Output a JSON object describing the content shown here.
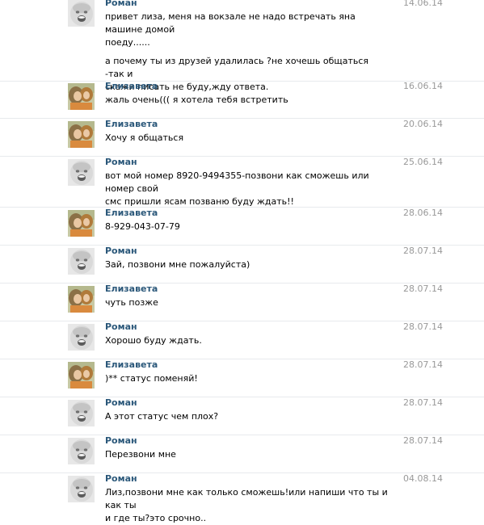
{
  "messages": [
    {
      "author": "Роман",
      "avatar": "baby-avatar",
      "date": "14.06.14",
      "text": [
        "привет лиза, меня на вокзале не надо встречать яна машине домой\nпоеду......",
        "а почему ты из друзей удалилась ?не хочешь общаться -так и\nскажи писать не буду,жду ответа."
      ]
    },
    {
      "author": "Елизавета",
      "avatar": "girl-avatar",
      "date": "16.06.14",
      "text": [
        "жаль очень((( я хотела тебя встретить"
      ]
    },
    {
      "author": "Елизавета",
      "avatar": "girl-avatar",
      "date": "20.06.14",
      "text": [
        "Хочу я общаться"
      ]
    },
    {
      "author": "Роман",
      "avatar": "baby-avatar",
      "date": "25.06.14",
      "text": [
        "вот мой номер 8920-9494355-позвони как сможешь или номер свой\nсмс пришли ясам позваню буду ждать!!"
      ]
    },
    {
      "author": "Елизавета",
      "avatar": "girl-avatar",
      "date": "28.06.14",
      "text": [
        "8-929-043-07-79"
      ]
    },
    {
      "author": "Роман",
      "avatar": "baby-avatar",
      "date": "28.07.14",
      "text": [
        "Зай, позвони мне пожалуйста)"
      ]
    },
    {
      "author": "Елизавета",
      "avatar": "girl-avatar",
      "date": "28.07.14",
      "text": [
        "чуть позже"
      ]
    },
    {
      "author": "Роман",
      "avatar": "baby-avatar",
      "date": "28.07.14",
      "text": [
        "Хорошо буду ждать."
      ]
    },
    {
      "author": "Елизавета",
      "avatar": "girl-avatar",
      "date": "28.07.14",
      "text": [
        ")** статус поменяй!"
      ]
    },
    {
      "author": "Роман",
      "avatar": "baby-avatar",
      "date": "28.07.14",
      "text": [
        "А этот статус чем плох?"
      ]
    },
    {
      "author": "Роман",
      "avatar": "baby-avatar",
      "date": "28.07.14",
      "text": [
        "Перезвони мне"
      ]
    },
    {
      "author": "Роман",
      "avatar": "baby-avatar",
      "date": "04.08.14",
      "text": [
        "Лиз,позвони мне как только сможешь!или напиши что ты и как ты\nи где ты?это срочно.."
      ]
    }
  ]
}
